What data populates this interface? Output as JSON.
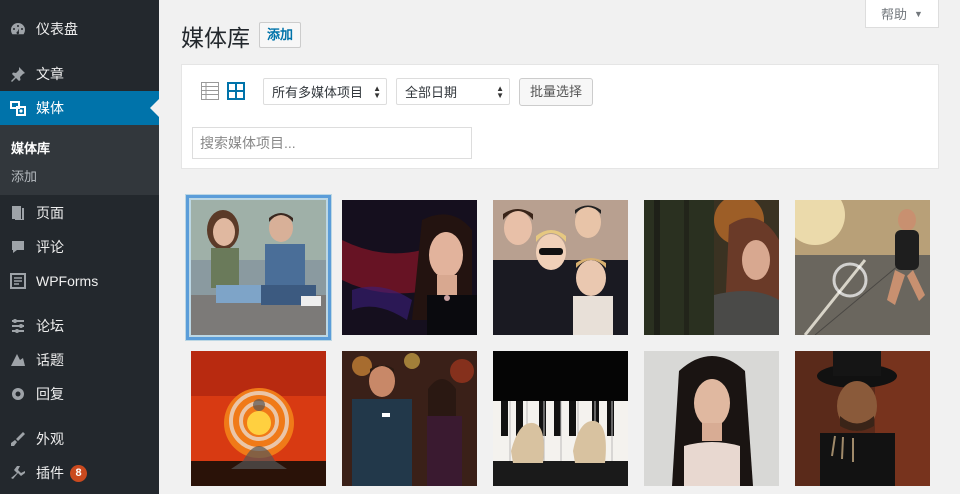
{
  "sidebar": {
    "items": [
      {
        "label": "仪表盘",
        "icon": "dashboard-icon"
      },
      {
        "label": "文章",
        "icon": "pin-icon"
      },
      {
        "label": "媒体",
        "icon": "media-icon"
      },
      {
        "label": "页面",
        "icon": "pages-icon"
      },
      {
        "label": "评论",
        "icon": "comments-icon"
      },
      {
        "label": "WPForms",
        "icon": "forms-icon"
      },
      {
        "label": "论坛",
        "icon": "forum-icon"
      },
      {
        "label": "话题",
        "icon": "topics-icon"
      },
      {
        "label": "回复",
        "icon": "replies-icon"
      },
      {
        "label": "外观",
        "icon": "appearance-icon"
      },
      {
        "label": "插件",
        "icon": "plugins-icon",
        "badge": "8"
      }
    ],
    "submenu": [
      "媒体库",
      "添加"
    ],
    "active": "媒体"
  },
  "header": {
    "title": "媒体库",
    "add_label": "添加",
    "help_label": "帮助"
  },
  "toolbar": {
    "media_type_select": "所有多媒体项目",
    "date_select": "全部日期",
    "bulk_select_label": "批量选择",
    "search_placeholder": "搜索媒体项目...",
    "view_mode": "grid"
  },
  "colors": {
    "sidebar_bg": "#23282d",
    "active_menu": "#0073aa",
    "badge": "#ca4a1f",
    "selection": "#5b9dd9"
  },
  "media_items": [
    {
      "subject": "teens-with-phones"
    },
    {
      "subject": "woman-red-hair-dark"
    },
    {
      "subject": "band-group-portrait"
    },
    {
      "subject": "woman-autumn-forest"
    },
    {
      "subject": "runner-on-road"
    },
    {
      "subject": "meditation-sunset"
    },
    {
      "subject": "bar-couple"
    },
    {
      "subject": "piano-hands"
    },
    {
      "subject": "woman-dark-hair"
    },
    {
      "subject": "man-in-hat"
    }
  ]
}
